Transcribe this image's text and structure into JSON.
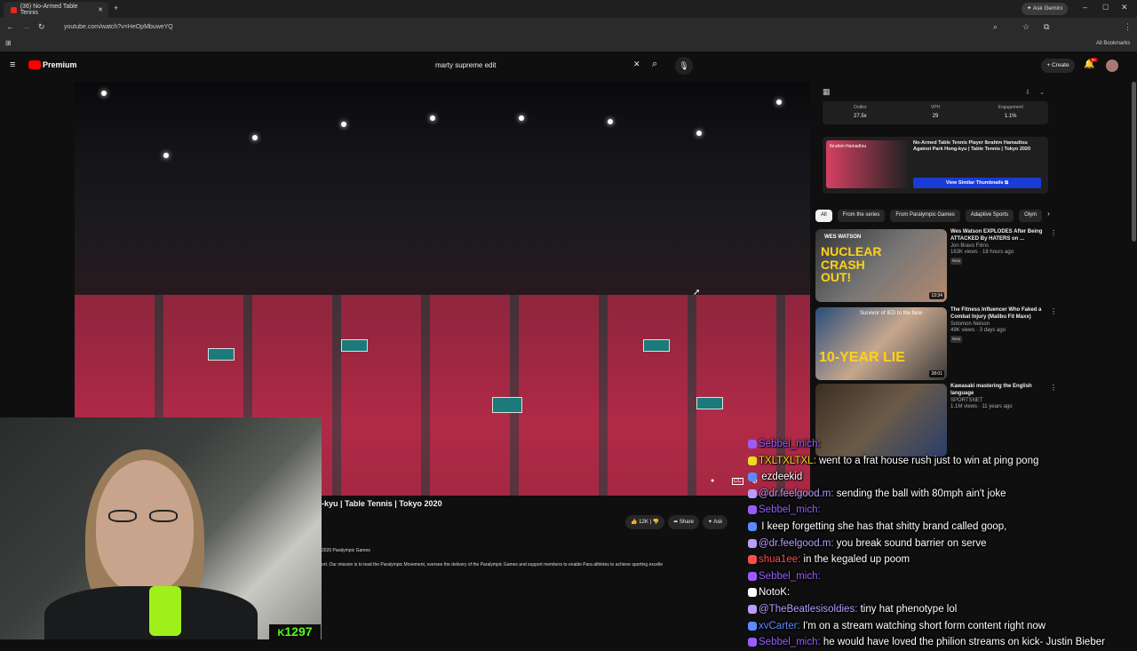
{
  "browser": {
    "tab_title": "(36) No-Armed Table Tennis",
    "url": "youtube.com/watch?v=HeOpMbuweYQ",
    "ask_gemini": "Ask Gemini",
    "all_bookmarks": "All Bookmarks"
  },
  "youtube": {
    "logo": "Premium",
    "search_value": "marty supreme edit",
    "create_label": "Create",
    "notif_count": "9+",
    "video_title": "-kyu | Table Tennis | Tokyo 2020",
    "channel_line": "2020 Paralympic Games",
    "description": "ort. Our mission is to lead the Paralympic Movement, oversee the delivery of the Paralympic Games and support members to enable Para athletes to achieve sporting excelle",
    "likes": "12K",
    "share_label": "Share",
    "ask_label": "Ask",
    "stats": [
      {
        "label": "Outlier",
        "value": "27.5x"
      },
      {
        "label": "VPH",
        "value": "29"
      },
      {
        "label": "Engagement",
        "value": "1.1%"
      }
    ],
    "thumb_card_title": "No-Armed Table Tennis Player Ibrahim Hamadtou Against Park Hong-kyu | Table Tennis | Tokyo 2020",
    "thumb_card_name": "Ibrahim Hamadtou",
    "similar_button": "View Similar Thumbnails",
    "chips": [
      "All",
      "From the series",
      "From Paralympic Games",
      "Adaptive Sports",
      "Olym"
    ],
    "videos": [
      {
        "title": "Wes Watson EXPLODES After Being ATTACKED By HATERS on ...",
        "channel": "Jon Bravo Films",
        "meta": "163K views · 18 hours ago",
        "badge": "New",
        "thumb_text": "NUCLEAR CRASH OUT!",
        "thumb_top": "WES WATSON",
        "duration": "13:34"
      },
      {
        "title": "The Fitness Influencer Who Faked a Combat Injury (Malibu Fit Maxx)",
        "channel": "Solomon Nelson",
        "meta": "49K views · 3 days ago",
        "badge": "New",
        "thumb_text": "10-YEAR LIE",
        "thumb_top": "Survivor of IED to the face",
        "duration": "28:01"
      },
      {
        "title": "Kawasaki mastering the English language",
        "channel": "SPORTSNET",
        "meta": "1.1M views · 11 years ago",
        "badge": "",
        "thumb_text": "",
        "thumb_top": "",
        "duration": ""
      }
    ]
  },
  "stream": {
    "sub_count": "1297",
    "chat": [
      {
        "user": "Sebbel_mich:",
        "text": "",
        "color": "#9b5cff"
      },
      {
        "user": "TXLTXLTXL:",
        "text": "went to a frat house rush just to win at ping pong",
        "color": "#e8e01a"
      },
      {
        "user": "",
        "text": "ezdeekid",
        "color": "#5b8bff"
      },
      {
        "user": "@dr.feelgood.m:",
        "text": "sending the ball with 80mph ain't joke",
        "color": "#b99cff"
      },
      {
        "user": "Sebbel_mich:",
        "text": "",
        "color": "#9b5cff"
      },
      {
        "user": "",
        "text": "I keep forgetting she has that shitty brand called goop,",
        "color": "#5b8bff"
      },
      {
        "user": "@dr.feelgood.m:",
        "text": "you break sound barrier on serve",
        "color": "#b99cff"
      },
      {
        "user": "shua1ee:",
        "text": "in the kegaled up poom",
        "color": "#ff4d4d"
      },
      {
        "user": "Sebbel_mich:",
        "text": "",
        "color": "#9b5cff"
      },
      {
        "user": "NotoK:",
        "text": "",
        "color": "#ffffff"
      },
      {
        "user": "@TheBeatlesisoldies:",
        "text": "tiny hat phenotype lol",
        "color": "#b99cff"
      },
      {
        "user": "xvCarter:",
        "text": "I'm on a stream watching short form content right now",
        "color": "#5b8bff"
      },
      {
        "user": "Sebbel_mich:",
        "text": "he would have loved the philion streams on kick- Justin Bieber",
        "color": "#9b5cff"
      }
    ]
  },
  "colors": {
    "yt_red": "#ff0000",
    "kick_green": "#53fc18",
    "similar_btn": "#1a3bd6"
  }
}
